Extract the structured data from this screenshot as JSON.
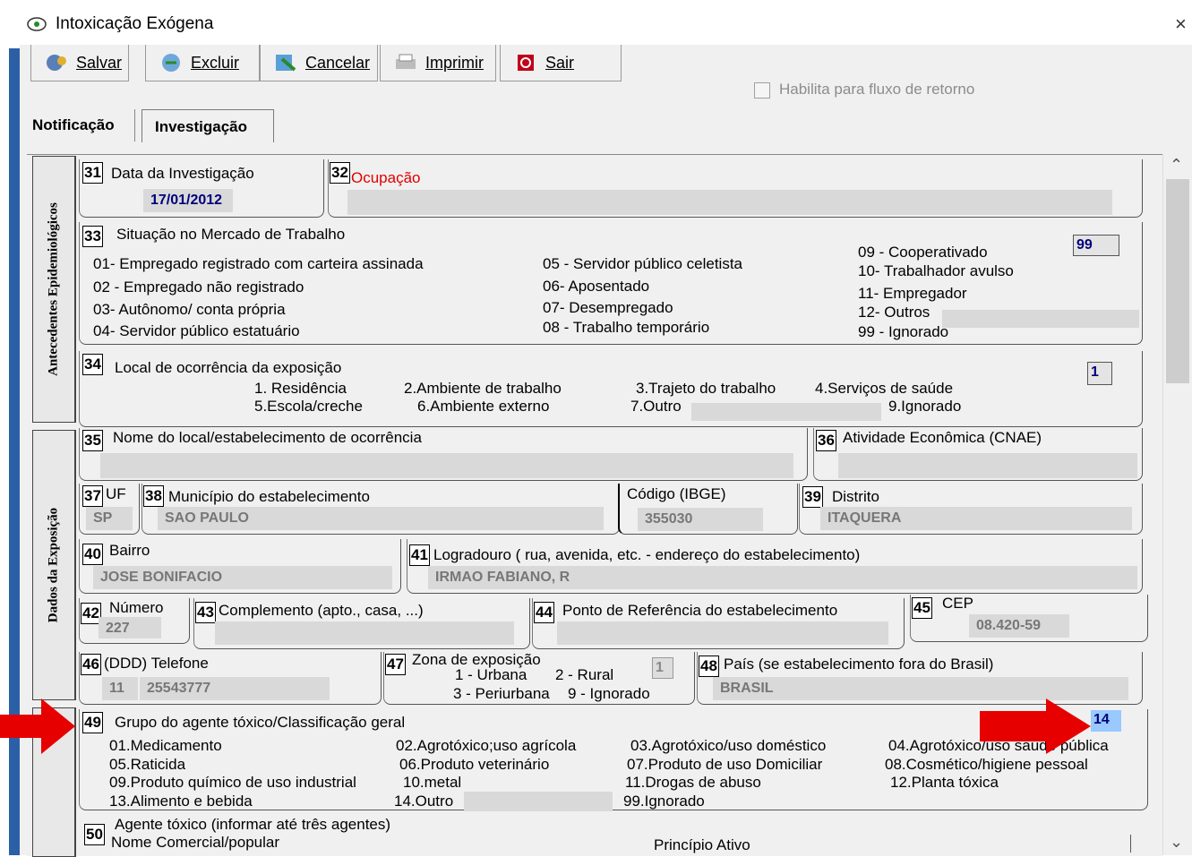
{
  "window": {
    "title": "Intoxicação Exógena",
    "close": "×"
  },
  "toolbar": {
    "save": "Salvar",
    "delete": "Excluir",
    "cancel": "Cancelar",
    "print": "Imprimir",
    "exit": "Sair"
  },
  "return_flow": {
    "label": "Habilita para fluxo de retorno",
    "checked": false
  },
  "tabs": {
    "notification": "Notificação",
    "investigation": "Investigação",
    "active": "Investigação"
  },
  "side_sections": {
    "antecedentes": "Antecedentes Epidemiológicos",
    "dados_exposicao": "Dados da Exposição"
  },
  "f31": {
    "num": "31",
    "label": "Data da Investigação",
    "value": "17/01/2012"
  },
  "f32": {
    "num": "32",
    "label": "Ocupação",
    "value": ""
  },
  "f33": {
    "num": "33",
    "label": "Situação no Mercado de Trabalho",
    "value": "99",
    "options": [
      "01- Empregado registrado com carteira assinada",
      "02 - Empregado não registrado",
      "03- Autônomo/ conta própria",
      "04- Servidor público estatuário",
      "05 - Servidor público celetista",
      "06- Aposentado",
      "07- Desempregado",
      "08 - Trabalho temporário",
      "09 - Cooperativado",
      "10- Trabalhador avulso",
      "11- Empregador",
      "12- Outros",
      "99 - Ignorado"
    ]
  },
  "f34": {
    "num": "34",
    "label": "Local de ocorrência da exposição",
    "value": "1",
    "options": [
      "1. Residência",
      "2.Ambiente de trabalho",
      "3.Trajeto do trabalho",
      "4.Serviços de saúde",
      "5.Escola/creche",
      "6.Ambiente externo",
      "7.Outro",
      "9.Ignorado"
    ]
  },
  "f35": {
    "num": "35",
    "label": "Nome do local/estabelecimento de ocorrência",
    "value": ""
  },
  "f36": {
    "num": "36",
    "label": "Atividade Econômica (CNAE)",
    "value": ""
  },
  "f37": {
    "num": "37",
    "label": "UF",
    "value": "SP"
  },
  "f38": {
    "num": "38",
    "label": "Município do estabelecimento",
    "value": "SAO PAULO",
    "ibge_label": "Código (IBGE)",
    "ibge_value": "355030"
  },
  "f39": {
    "num": "39",
    "label": "Distrito",
    "value": "ITAQUERA"
  },
  "f40": {
    "num": "40",
    "label": "Bairro",
    "value": "JOSE BONIFACIO"
  },
  "f41": {
    "num": "41",
    "label": "Logradouro ( rua, avenida, etc. - endereço do estabelecimento)",
    "value": "IRMAO FABIANO, R"
  },
  "f42": {
    "num": "42",
    "label": "Número",
    "value": "227"
  },
  "f43": {
    "num": "43",
    "label": "Complemento (apto., casa, ...)",
    "value": ""
  },
  "f44": {
    "num": "44",
    "label": "Ponto de Referência do estabelecimento",
    "value": ""
  },
  "f45": {
    "num": "45",
    "label": "CEP",
    "value": "08.420-59"
  },
  "f46": {
    "num": "46",
    "label": "(DDD) Telefone",
    "ddd": "11",
    "phone": "25543777"
  },
  "f47": {
    "num": "47",
    "label": "Zona de exposição",
    "value": "1",
    "options": [
      "1 - Urbana",
      "2 - Rural",
      "3 - Periurbana",
      "9 - Ignorado"
    ]
  },
  "f48": {
    "num": "48",
    "label": "País (se estabelecimento fora do Brasil)",
    "value": "BRASIL"
  },
  "f49": {
    "num": "49",
    "label": "Grupo do agente tóxico/Classificação geral",
    "value": "14",
    "options": [
      "01.Medicamento",
      "02.Agrotóxico;uso agrícola",
      "03.Agrotóxico/uso doméstico",
      "04.Agrotóxico/uso saúde pública",
      "05.Raticida",
      "06.Produto veterinário",
      "07.Produto de uso Domiciliar",
      "08.Cosmético/higiene pessoal",
      "09.Produto químico de uso industrial",
      "10.metal",
      "11.Drogas de abuso",
      "12.Planta tóxica",
      "13.Alimento e bebida",
      "14.Outro",
      "99.Ignorado"
    ]
  },
  "f50": {
    "num": "50",
    "label": "Agente tóxico (informar até três agentes)",
    "col1": "Nome Comercial/popular",
    "col2": "Princípio Ativo"
  },
  "colors": {
    "arrow": "#e60000",
    "highlight": "#99c9ff",
    "required": "#e00000"
  }
}
